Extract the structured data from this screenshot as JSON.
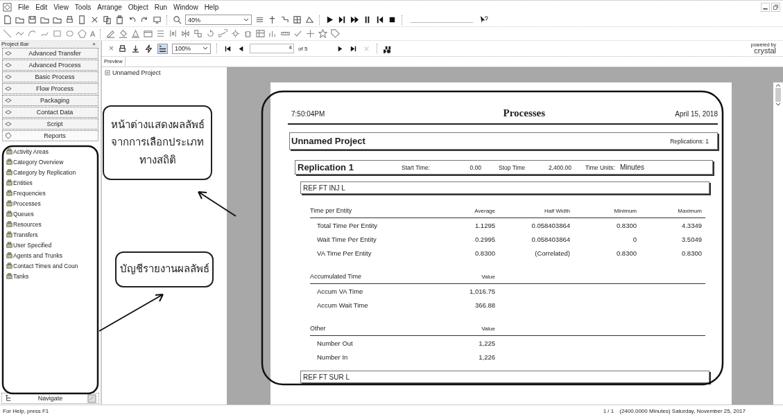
{
  "menu": [
    "File",
    "Edit",
    "View",
    "Tools",
    "Arrange",
    "Object",
    "Run",
    "Window",
    "Help"
  ],
  "toolbar": {
    "zoom": "40%",
    "text_tool": "A"
  },
  "project_bar": {
    "title": "Project Bar",
    "close": "×",
    "panels": [
      {
        "label": "Advanced Transfer",
        "expanded": false
      },
      {
        "label": "Advanced Process",
        "expanded": false
      },
      {
        "label": "Basic Process",
        "expanded": false
      },
      {
        "label": "Flow Process",
        "expanded": false
      },
      {
        "label": "Packaging",
        "expanded": false
      },
      {
        "label": "Contact Data",
        "expanded": false
      },
      {
        "label": "Script",
        "expanded": false
      },
      {
        "label": "Reports",
        "expanded": true
      }
    ],
    "reports": [
      "Activity Areas",
      "Category Overview",
      "Category by Replication",
      "Entities",
      "Frequencies",
      "Processes",
      "Queues",
      "Resources",
      "Transfers",
      "User Specified",
      "Agents and Trunks",
      "Contact Times and Coun",
      "Tanks"
    ],
    "navigate": "Navigate"
  },
  "report_toolbar": {
    "close": "×",
    "zoom": "100%",
    "page": "4",
    "page_count": "of 5",
    "brand_note": "powered by",
    "brand": "crystal"
  },
  "preview_tab": "Preview",
  "tree": [
    {
      "label": "Unnamed Project",
      "expanded": false
    }
  ],
  "report": {
    "time": "7:50:04PM",
    "title": "Processes",
    "date": "April 15, 2018",
    "project": "Unnamed Project",
    "replications": "Replications: 1",
    "replication": "Replication 1",
    "start_label": "Start Time:",
    "start": "0.00",
    "stop_label": "Stop Time",
    "stop": "2,400.00",
    "units_label": "Time Units:",
    "units": "Minutes",
    "entity": "REF FT INJ L",
    "sections": [
      {
        "columns": [
          "Time per Entity",
          "Average",
          "Half Width",
          "Minimum",
          "Maximum"
        ],
        "rows": [
          [
            "Total Time Per Entity",
            "1.1295",
            "0.058403864",
            "0.8300",
            "4.3349"
          ],
          [
            "Wait Time Per Entity",
            "0.2995",
            "0.058403864",
            "0",
            "3.5049"
          ],
          [
            "VA Time Per Entity",
            "0.8300",
            "(Correlated)",
            "0.8300",
            "0.8300"
          ]
        ]
      },
      {
        "columns": [
          "Accumulated Time",
          "Value"
        ],
        "rows": [
          [
            "Accum VA Time",
            "1,016.75"
          ],
          [
            "Accum Wait Time",
            "366.88"
          ]
        ]
      },
      {
        "columns": [
          "Other",
          "Value"
        ],
        "rows": [
          [
            "Number Out",
            "1,225"
          ],
          [
            "Number In",
            "1,226"
          ]
        ]
      }
    ],
    "next_entity": "REF FT SUR L"
  },
  "annotations": [
    {
      "kind": "callout",
      "lines": [
        "หน้าต่างแสดงผลลัพธ์",
        "จากการเลือกประเภท",
        "ทางสถิติ"
      ]
    },
    {
      "kind": "callout",
      "lines": [
        "บัญชีรายงานผลลัพธ์"
      ]
    }
  ],
  "status_bar": {
    "help": "For Help, press F1",
    "position": "1 / 1",
    "info": "(2400.0000 Minutes) Saturday, November 25, 2017"
  }
}
